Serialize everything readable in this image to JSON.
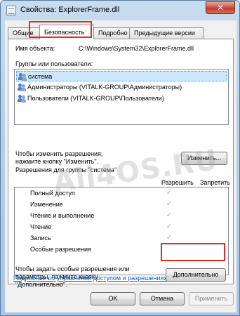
{
  "window": {
    "title": "Свойства: ExplorerFrame.dll",
    "close_glyph": "✕"
  },
  "tabs": [
    {
      "label": "Общие"
    },
    {
      "label": "Безопасность"
    },
    {
      "label": "Подробно"
    },
    {
      "label": "Предыдущие версии"
    }
  ],
  "object": {
    "label": "Имя объекта:",
    "value": "C:\\Windows\\System32\\ExplorerFrame.dll"
  },
  "groups": {
    "label": "Группы или пользователи:",
    "items": [
      {
        "name": "система",
        "icon": "users-icon",
        "selected": true
      },
      {
        "name": "Администраторы (VITALK-GROUP\\Администраторы)",
        "icon": "users-icon"
      },
      {
        "name": "Пользователи (VITALK-GROUP\\Пользователи)",
        "icon": "users-icon"
      }
    ]
  },
  "change": {
    "hint_line1": "Чтобы изменить разрешения,",
    "hint_line2": "нажмите кнопку \"Изменить\".",
    "button": "Изменить..."
  },
  "permissions": {
    "label": "Разрешения для группы \"система\"",
    "allow_header": "Разрешить",
    "deny_header": "Запретить",
    "check_glyph": "✓",
    "rows": [
      {
        "name": "Полный доступ",
        "allow": true,
        "deny": false
      },
      {
        "name": "Изменение",
        "allow": true,
        "deny": false
      },
      {
        "name": "Чтение и выполнение",
        "allow": true,
        "deny": false
      },
      {
        "name": "Чтение",
        "allow": true,
        "deny": false
      },
      {
        "name": "Запись",
        "allow": true,
        "deny": false
      },
      {
        "name": "Особые разрешения",
        "allow": false,
        "deny": false
      }
    ]
  },
  "advanced": {
    "hint_line1": "Чтобы задать особые разрешения или",
    "hint_line2": "параметры, нажмите кнопку",
    "hint_line3": "\"Дополнительно\".",
    "button": "Дополнительно"
  },
  "link": "Подробнее об управлении доступом и разрешениях",
  "footer": {
    "ok": "OK",
    "cancel": "Отмена",
    "apply": "Применить"
  },
  "watermark": "All4OS.RU",
  "colors": {
    "highlight": "#e02b2b",
    "selection": "#cce8ff",
    "link": "#0066cc"
  }
}
